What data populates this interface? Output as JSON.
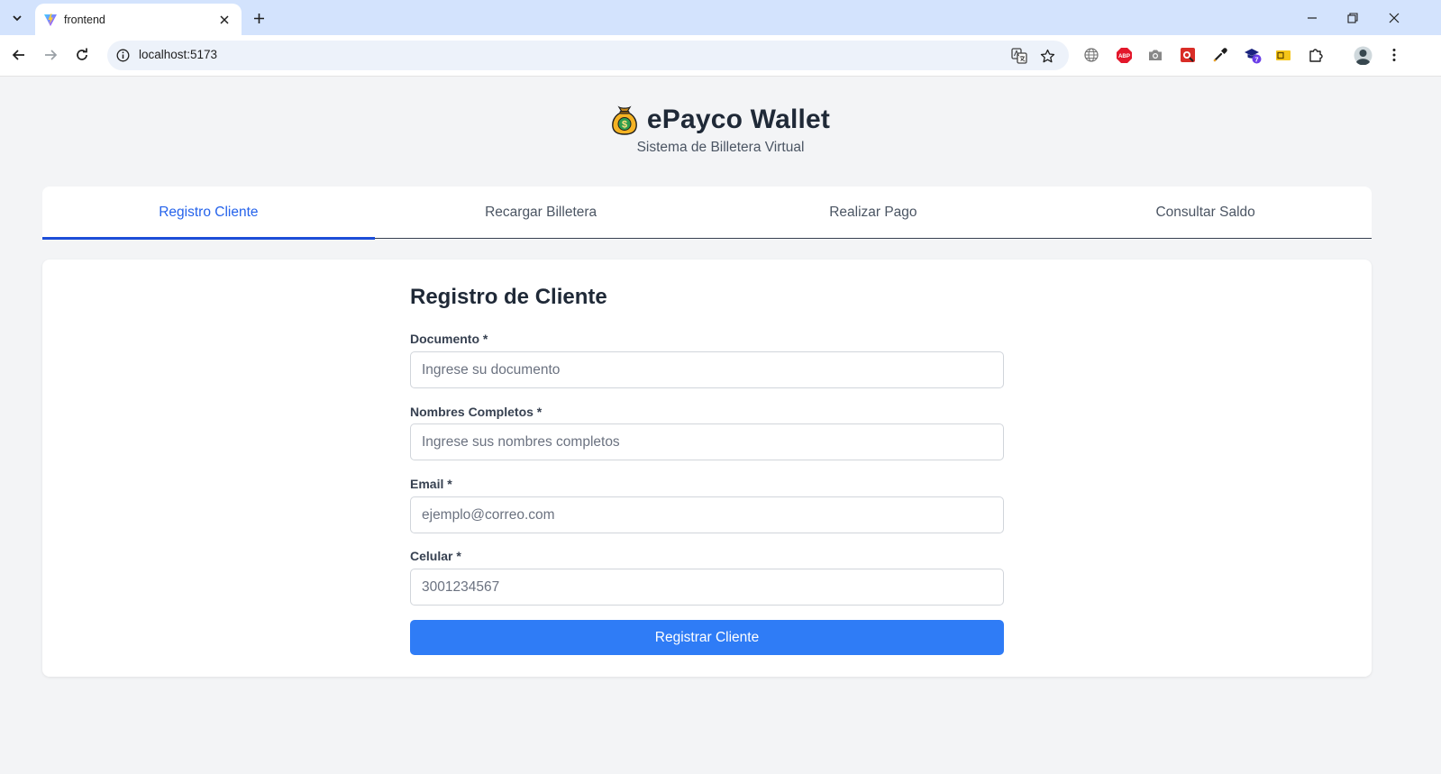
{
  "browser": {
    "tab_title": "frontend",
    "url": "localhost:5173",
    "extension_badge": "7"
  },
  "app": {
    "title": "ePayco Wallet",
    "subtitle": "Sistema de Billetera Virtual",
    "logo_icon": "money-bag-icon"
  },
  "tabs": [
    {
      "label": "Registro Cliente",
      "active": true
    },
    {
      "label": "Recargar Billetera",
      "active": false
    },
    {
      "label": "Realizar Pago",
      "active": false
    },
    {
      "label": "Consultar Saldo",
      "active": false
    }
  ],
  "form": {
    "title": "Registro de Cliente",
    "fields": [
      {
        "label": "Documento *",
        "placeholder": "Ingrese su documento",
        "value": ""
      },
      {
        "label": "Nombres Completos *",
        "placeholder": "Ingrese sus nombres completos",
        "value": ""
      },
      {
        "label": "Email *",
        "placeholder": "ejemplo@correo.com",
        "value": ""
      },
      {
        "label": "Celular *",
        "placeholder": "3001234567",
        "value": ""
      }
    ],
    "submit_label": "Registrar Cliente"
  },
  "colors": {
    "accent": "#2f7cf6",
    "active_tab": "#2563eb",
    "page_bg": "#f3f4f6",
    "chrome_bg": "#d3e3fd"
  }
}
